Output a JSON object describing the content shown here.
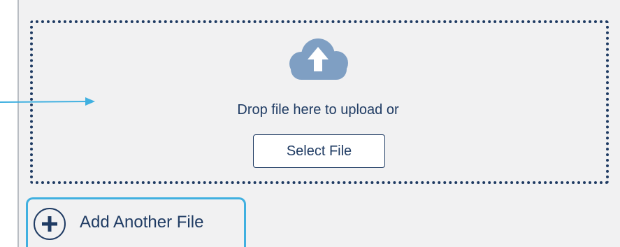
{
  "dropzone": {
    "icon": "cloud-upload-icon",
    "text": "Drop file here to upload or",
    "select_button_label": "Select File"
  },
  "add_file": {
    "icon": "plus-circle-icon",
    "label": "Add Another File"
  },
  "colors": {
    "text": "#1f3b63",
    "cloud": "#7f9fc3",
    "highlight": "#40b0e0",
    "panel_background": "#f1f1f2"
  }
}
